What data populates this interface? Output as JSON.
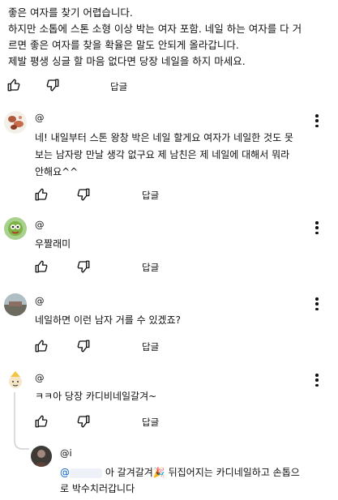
{
  "top_comment": {
    "lines": [
      "좋은 여자를 찾기 어렵습니다.",
      "하지만 소톱에 스톤 소형 이상 박는 여자 포함. 네일 하는 여자를 다 거",
      "르면 좋은 여자를 찾을 확율은 말도 안되게 올라갑니다.",
      "제발 평생 싱글 할 마음 없다면 당장 네일을 하지 마세요."
    ],
    "reply_label": "답글"
  },
  "replies": [
    {
      "handle": "@",
      "lines": [
        "네! 내일부터 스톤 왕창 박은 네일 할게요 여자가 네일한 것도 못",
        "보는 남자랑 만날 생각 없구요 제 남친은 제 네일에 대해서 뭐라",
        "안해요^^"
      ],
      "reply_label": "답글"
    },
    {
      "handle": "@",
      "lines": [
        "우짤래미"
      ],
      "reply_label": "답글"
    },
    {
      "handle": "@",
      "lines": [
        "네일하면 이런 남자 거를 수 있겠죠?"
      ],
      "reply_label": "답글"
    },
    {
      "handle": "@",
      "lines": [
        "ㅋㅋ아 당장 카디비네일갈겨~"
      ],
      "reply_label": "답글"
    }
  ],
  "nested_reply": {
    "handle": "@i",
    "mention": "@",
    "line1_rest": "아 갈겨갈겨🎉 뒤집어지는 카디네일하고 손톱으",
    "line2": "로 박수치러갑니다"
  },
  "icons": {
    "like": "thumbs-up-icon",
    "dislike": "thumbs-down-icon",
    "more": "more-vertical-icon"
  },
  "colors": {
    "text": "#0f0f0f",
    "mention": "#065fd4",
    "thread_line": "#d0d0d0"
  }
}
